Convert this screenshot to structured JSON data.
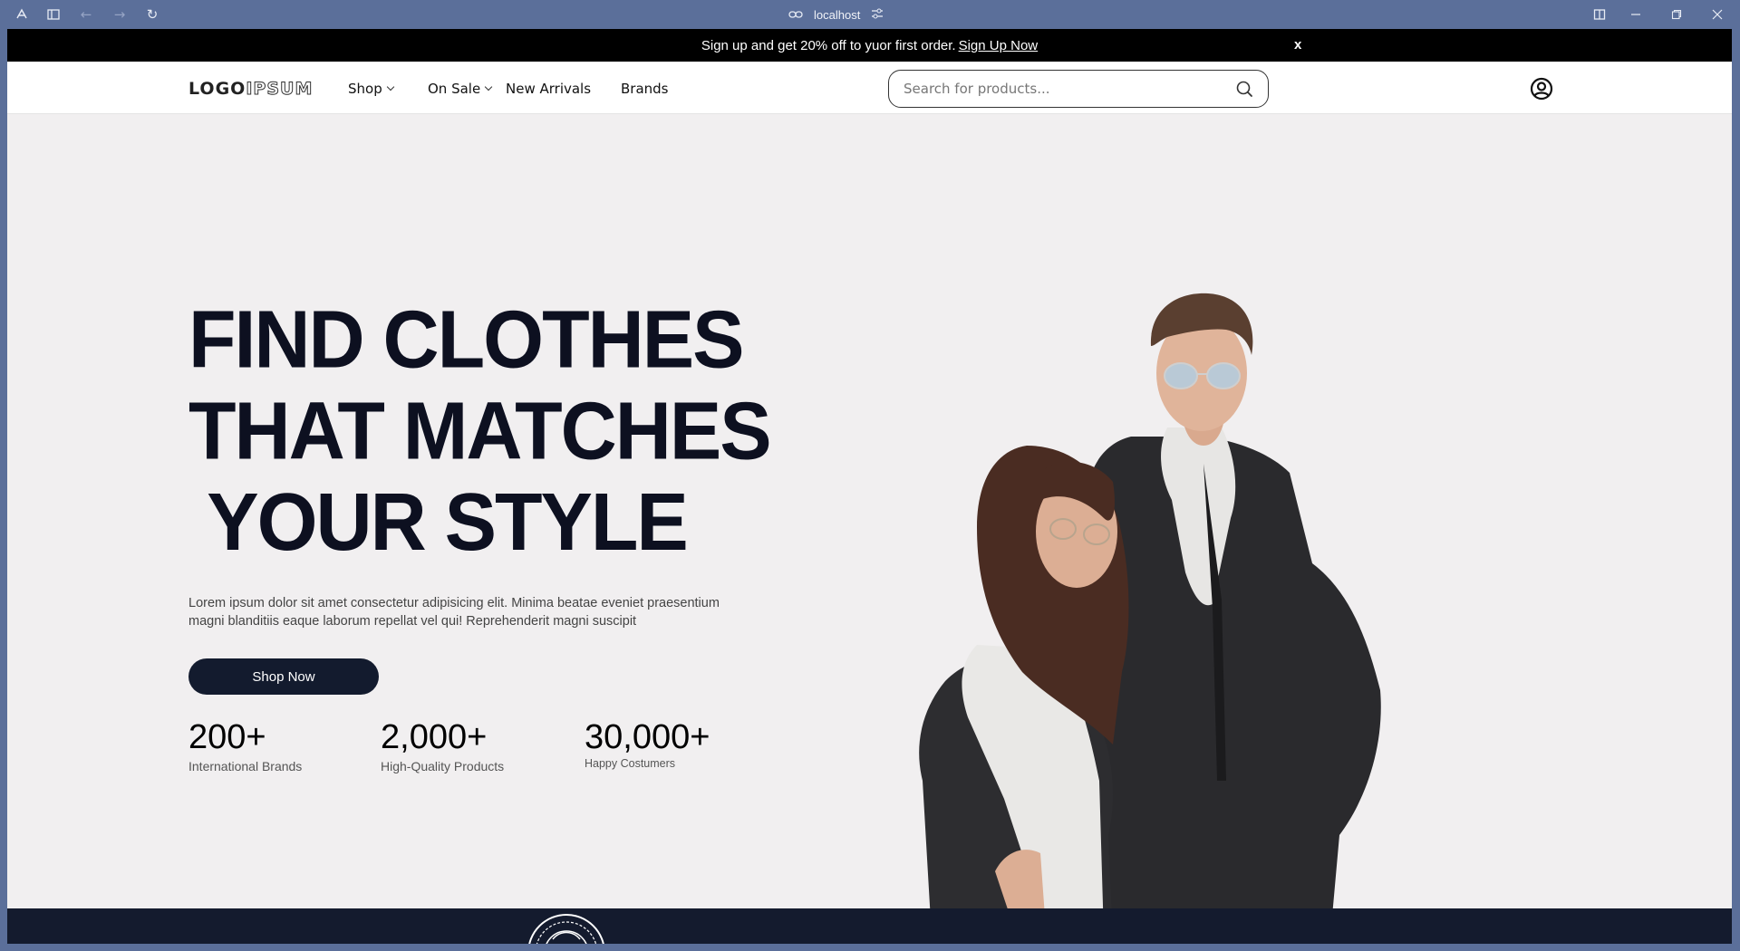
{
  "browser": {
    "url": "localhost",
    "icons": [
      "app-icon",
      "sidebar-toggle-icon",
      "back-icon",
      "forward-icon",
      "reload-icon",
      "link-icon",
      "site-settings-icon",
      "split-view-icon",
      "minimize-icon",
      "restore-icon",
      "close-window-icon"
    ]
  },
  "promo": {
    "text": "Sign up and get 20% off to yuor first order.",
    "link": "Sign Up Now",
    "close": "x"
  },
  "nav": {
    "logo_part1": "LOGO",
    "logo_part2": "IPSUM",
    "items": [
      {
        "label": "Shop",
        "dropdown": true
      },
      {
        "label": "On Sale",
        "dropdown": true
      },
      {
        "label": "New Arrivals",
        "dropdown": false
      },
      {
        "label": "Brands",
        "dropdown": false
      }
    ],
    "search_placeholder": "Search for products...",
    "user_icon": "user-circle-icon"
  },
  "hero": {
    "title_lines": [
      "FIND CLOTHES",
      "THAT MATCHES",
      "YOUR STYLE"
    ],
    "description": "Lorem ipsum dolor sit amet consectetur adipisicing elit. Minima beatae eveniet praesentium magni blanditiis eaque laborum repellat vel qui! Reprehenderit magni suscipit",
    "cta": "Shop Now",
    "stats": [
      {
        "value": "200+",
        "label": "International Brands"
      },
      {
        "value": "2,000+",
        "label": "High-Quality Products"
      },
      {
        "value": "30,000+",
        "label": "Happy Costumers"
      }
    ]
  },
  "colors": {
    "chrome": "#5b6f9a",
    "page_bg": "#f1eff0",
    "promo_bg": "#000000",
    "primary_dark": "#131b2e"
  }
}
